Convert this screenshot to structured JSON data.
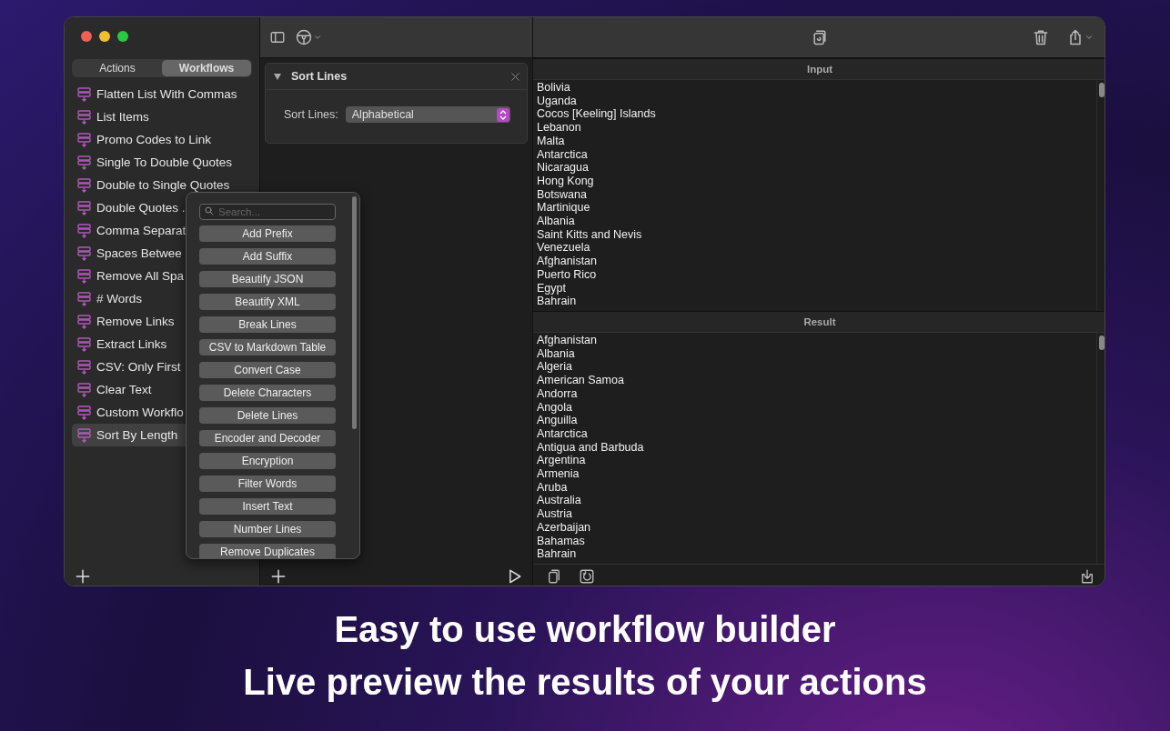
{
  "sidebar": {
    "tabs": [
      {
        "label": "Actions",
        "selected": false
      },
      {
        "label": "Workflows",
        "selected": true
      }
    ],
    "items": [
      {
        "label": "Flatten List With Commas",
        "selected": false
      },
      {
        "label": "List Items",
        "selected": false
      },
      {
        "label": "Promo Codes to Link",
        "selected": false
      },
      {
        "label": "Single To Double Quotes",
        "selected": false
      },
      {
        "label": "Double to Single Quotes",
        "selected": false
      },
      {
        "label": "Double Quotes .",
        "selected": false
      },
      {
        "label": "Comma Separat",
        "selected": false
      },
      {
        "label": "Spaces Betwee",
        "selected": false
      },
      {
        "label": "Remove All Spa",
        "selected": false
      },
      {
        "label": "# Words",
        "selected": false
      },
      {
        "label": "Remove Links",
        "selected": false
      },
      {
        "label": "Extract Links",
        "selected": false
      },
      {
        "label": "CSV: Only First",
        "selected": false
      },
      {
        "label": "Clear Text",
        "selected": false
      },
      {
        "label": "Custom Workflo",
        "selected": false
      },
      {
        "label": "Sort By Length",
        "selected": true
      }
    ]
  },
  "action_card": {
    "title": "Sort Lines",
    "expanded": true,
    "field_label": "Sort Lines:",
    "value": "Alphabetical"
  },
  "action_popover": {
    "search_placeholder": "Search...",
    "actions": [
      "Add Prefix",
      "Add Suffix",
      "Beautify JSON",
      "Beautify XML",
      "Break Lines",
      "CSV to Markdown Table",
      "Convert Case",
      "Delete Characters",
      "Delete Lines",
      "Encoder and Decoder",
      "Encryption",
      "Filter Words",
      "Insert Text",
      "Number Lines",
      "Remove Duplicates"
    ]
  },
  "input": {
    "title": "Input",
    "lines": [
      "Bolivia",
      "Uganda",
      "Cocos [Keeling] Islands",
      "Lebanon",
      "Malta",
      "Antarctica",
      "Nicaragua",
      "Hong Kong",
      "Botswana",
      "Martinique",
      "Albania",
      "Saint Kitts and Nevis",
      "Venezuela",
      "Afghanistan",
      "Puerto Rico",
      "Egypt",
      "Bahrain"
    ]
  },
  "result": {
    "title": "Result",
    "lines": [
      "Afghanistan",
      "Albania",
      "Algeria",
      "American Samoa",
      "Andorra",
      "Angola",
      "Anguilla",
      "Antarctica",
      "Antigua and Barbuda",
      "Argentina",
      "Armenia",
      "Aruba",
      "Australia",
      "Austria",
      "Azerbaijan",
      "Bahamas",
      "Bahrain"
    ]
  },
  "captions": [
    "Easy to use workflow builder",
    "Live preview the results of your actions"
  ]
}
